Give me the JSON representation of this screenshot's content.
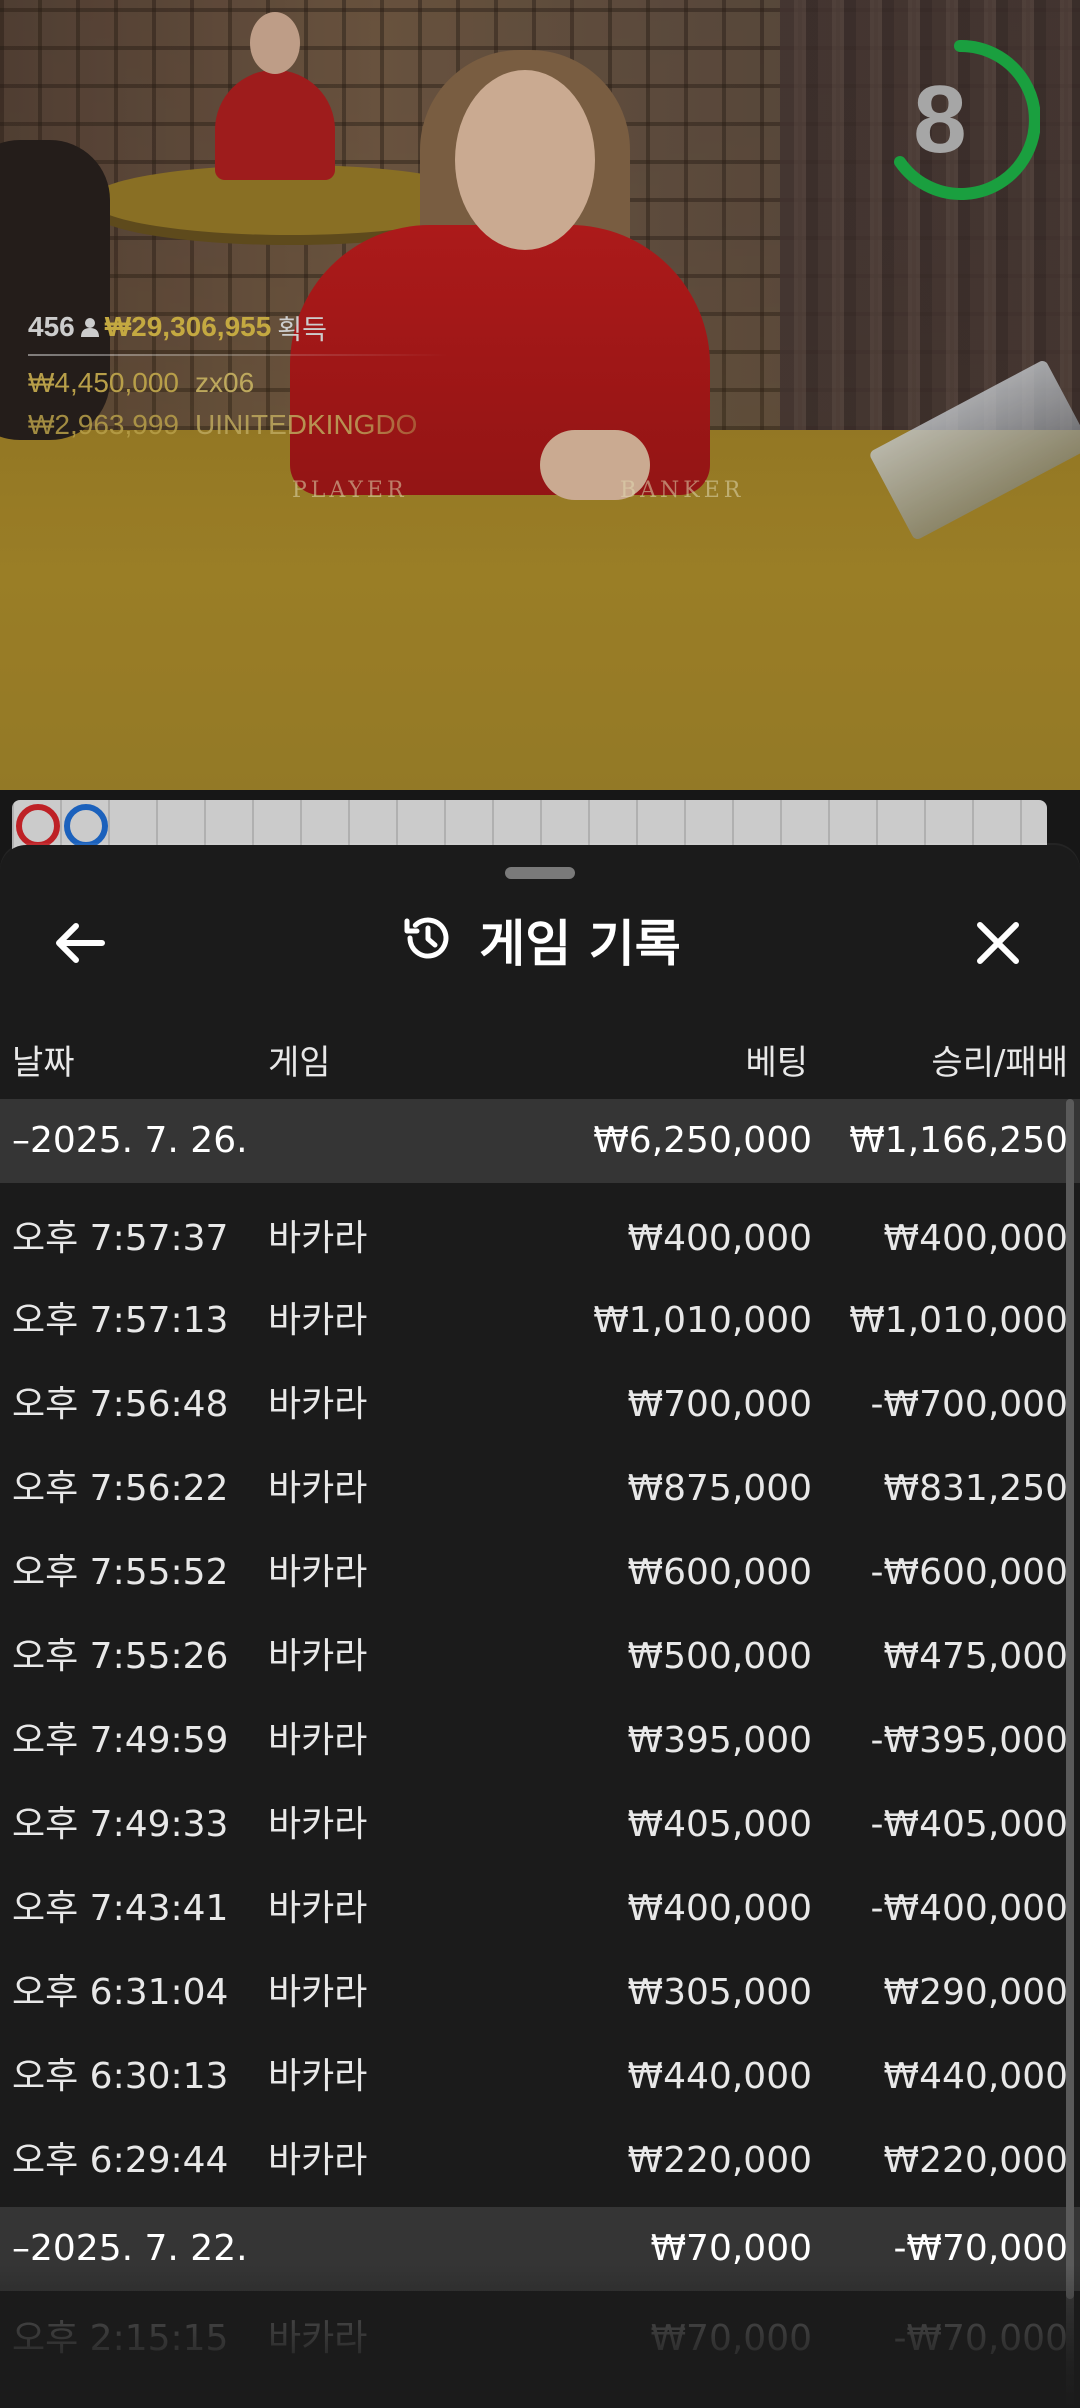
{
  "live": {
    "timer": "8",
    "timer_color": "#1eb648",
    "table_labels": {
      "player": "PLAYER",
      "banker": "BANKER"
    },
    "winners": {
      "count": "456",
      "total": "₩29,306,955",
      "total_label": "획득",
      "list": [
        {
          "amount": "₩4,450,000",
          "name": "zx06"
        },
        {
          "amount": "₩2,963,999",
          "name": "UINITEDKINGDO"
        }
      ]
    }
  },
  "sheet": {
    "title": "게임 기록",
    "columns": {
      "date": "날짜",
      "game": "게임",
      "bet": "베팅",
      "win": "승리/패배"
    },
    "groups": [
      {
        "date": "–2025. 7. 26.",
        "total_bet": "₩6,250,000",
        "total_win": "₩1,166,250",
        "rows": [
          {
            "time": "오후 7:57:37",
            "game": "바카라",
            "bet": "₩400,000",
            "win": "₩400,000"
          },
          {
            "time": "오후 7:57:13",
            "game": "바카라",
            "bet": "₩1,010,000",
            "win": "₩1,010,000"
          },
          {
            "time": "오후 7:56:48",
            "game": "바카라",
            "bet": "₩700,000",
            "win": "-₩700,000"
          },
          {
            "time": "오후 7:56:22",
            "game": "바카라",
            "bet": "₩875,000",
            "win": "₩831,250"
          },
          {
            "time": "오후 7:55:52",
            "game": "바카라",
            "bet": "₩600,000",
            "win": "-₩600,000"
          },
          {
            "time": "오후 7:55:26",
            "game": "바카라",
            "bet": "₩500,000",
            "win": "₩475,000"
          },
          {
            "time": "오후 7:49:59",
            "game": "바카라",
            "bet": "₩395,000",
            "win": "-₩395,000"
          },
          {
            "time": "오후 7:49:33",
            "game": "바카라",
            "bet": "₩405,000",
            "win": "-₩405,000"
          },
          {
            "time": "오후 7:43:41",
            "game": "바카라",
            "bet": "₩400,000",
            "win": "-₩400,000"
          },
          {
            "time": "오후 6:31:04",
            "game": "바카라",
            "bet": "₩305,000",
            "win": "₩290,000"
          },
          {
            "time": "오후 6:30:13",
            "game": "바카라",
            "bet": "₩440,000",
            "win": "₩440,000"
          },
          {
            "time": "오후 6:29:44",
            "game": "바카라",
            "bet": "₩220,000",
            "win": "₩220,000"
          }
        ]
      },
      {
        "date": "–2025. 7. 22.",
        "total_bet": "₩70,000",
        "total_win": "-₩70,000",
        "rows": [
          {
            "time": "오후 2:15:15",
            "game": "바카라",
            "bet": "₩70,000",
            "win": "-₩70,000"
          }
        ]
      }
    ]
  }
}
